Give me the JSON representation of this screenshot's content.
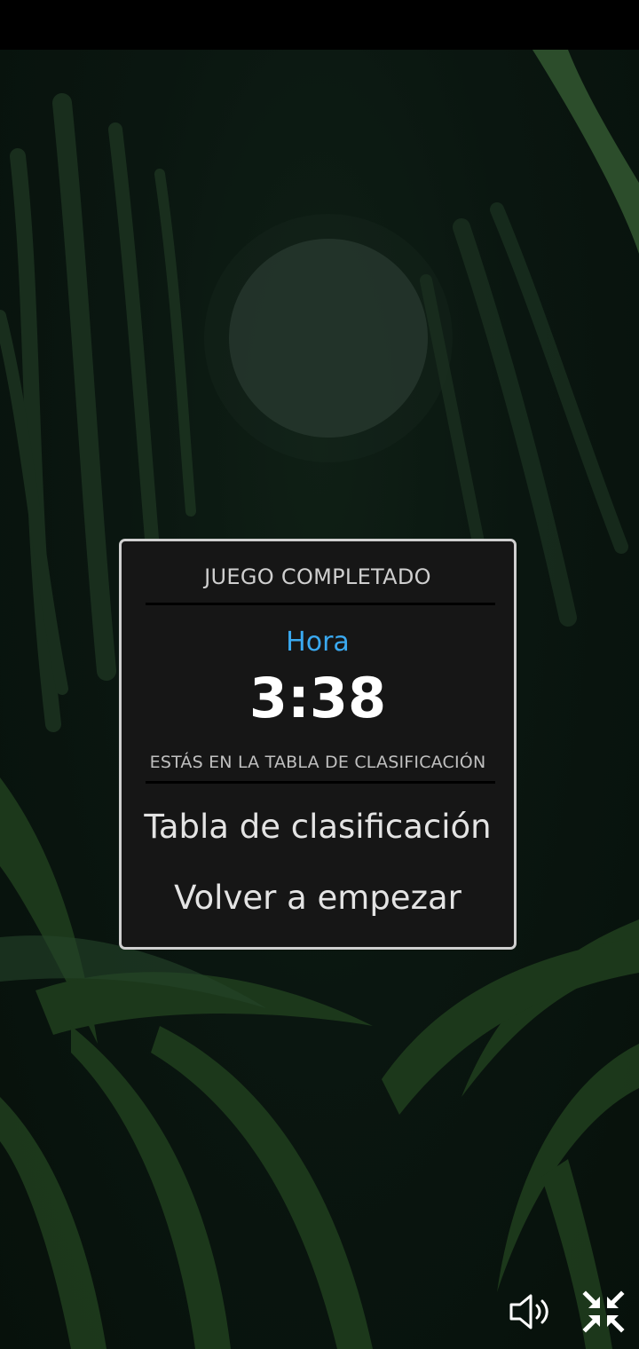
{
  "dialog": {
    "title": "JUEGO COMPLETADO",
    "time_label": "Hora",
    "time_value": "3:38",
    "leaderboard_note": "ESTÁS EN LA TABLA DE CLASIFICACIÓN",
    "leaderboard_button": "Tabla de clasificación",
    "restart_button": "Volver a empezar"
  },
  "controls": {
    "sound_icon": "speaker-icon",
    "exit_fullscreen_icon": "exit-fullscreen-icon"
  },
  "colors": {
    "accent": "#3aa9f0",
    "dialog_background": "#161616",
    "dialog_border": "#cfcfcf",
    "scene_background": "#0a1610"
  }
}
